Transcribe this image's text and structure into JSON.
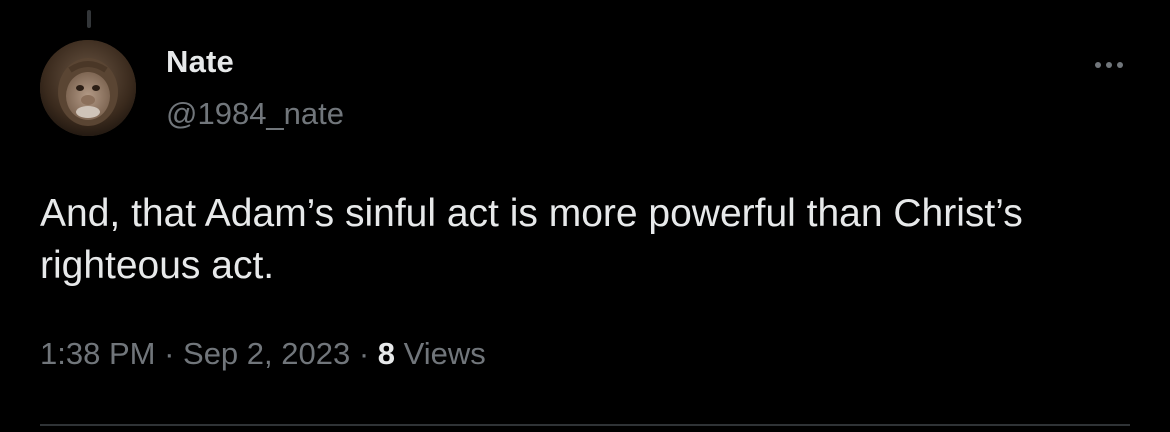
{
  "author": {
    "name": "Nate",
    "handle": "@1984_nate"
  },
  "tweet": {
    "text": "And, that Adam’s sinful act is more powerful than Christ’s righteous act."
  },
  "meta": {
    "time": "1:38 PM",
    "separator": " · ",
    "date": "Sep 2, 2023",
    "views_count": "8",
    "views_label": " Views"
  },
  "icons": {
    "more": "more-horizontal-icon"
  },
  "colors": {
    "background": "#000000",
    "primary_text": "#e7e9ea",
    "secondary_text": "#71767b",
    "divider": "#2f3336"
  }
}
